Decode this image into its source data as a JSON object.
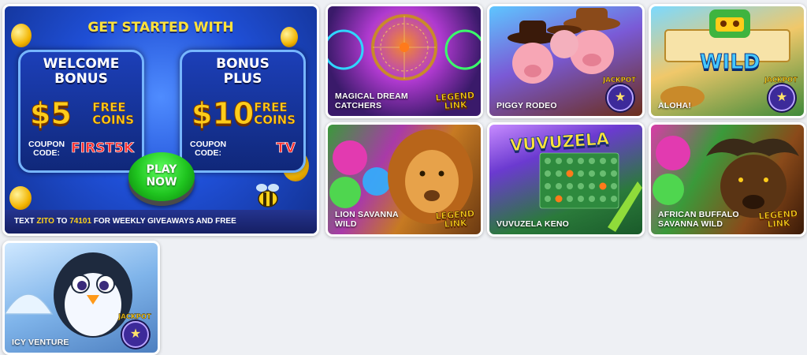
{
  "promo": {
    "title": "GET STARTED WITH",
    "box1": {
      "line1": "WELCOME",
      "line2": "BONUS",
      "amount": "$5",
      "free1": "FREE",
      "free2": "COINS",
      "code_label1": "COUPON",
      "code_label2": "CODE:",
      "code": "FIRST5K"
    },
    "box2": {
      "line1": "BONUS",
      "line2": "PLUS",
      "amount": "$10",
      "free1": "FREE",
      "free2": "COINS",
      "code_label1": "COUPON",
      "code_label2": "CODE:",
      "code": "TV"
    },
    "play_line1": "PLAY",
    "play_line2": "NOW",
    "strip_pre": "TEXT",
    "strip_word": "ZITO",
    "strip_to": "TO",
    "strip_number": "74101",
    "strip_post": "FOR WEEKLY GIVEAWAYS AND FREE"
  },
  "games": [
    {
      "name": "MAGICAL DREAM CATCHERS",
      "badge": "legend",
      "badge_line1": "LEGEND",
      "badge_line2": "LINK"
    },
    {
      "name": "PIGGY RODEO",
      "badge": "jackpot",
      "badge_text": "JACKPOT"
    },
    {
      "name": "ALOHA!",
      "badge": "jackpot",
      "badge_text": "JACKPOT",
      "art_text": "WILD"
    },
    {
      "name": "LION SAVANNA WILD",
      "badge": "legend",
      "badge_line1": "LEGEND",
      "badge_line2": "LINK"
    },
    {
      "name": "VUVUZELA KENO",
      "badge": "none",
      "art_text": "VUVUZELA"
    },
    {
      "name": "AFRICAN BUFFALO SAVANNA WILD",
      "badge": "legend",
      "badge_line1": "LEGEND",
      "badge_line2": "LINK"
    },
    {
      "name": "ICY VENTURE",
      "badge": "jackpot",
      "badge_text": "JACKPOT"
    }
  ],
  "colors": {
    "page_bg": "#eef0f4",
    "promo_blue": "#1f4fd6",
    "gold": "#ffd21a",
    "code_red": "#ff3030",
    "play_green": "#1fc41f"
  }
}
